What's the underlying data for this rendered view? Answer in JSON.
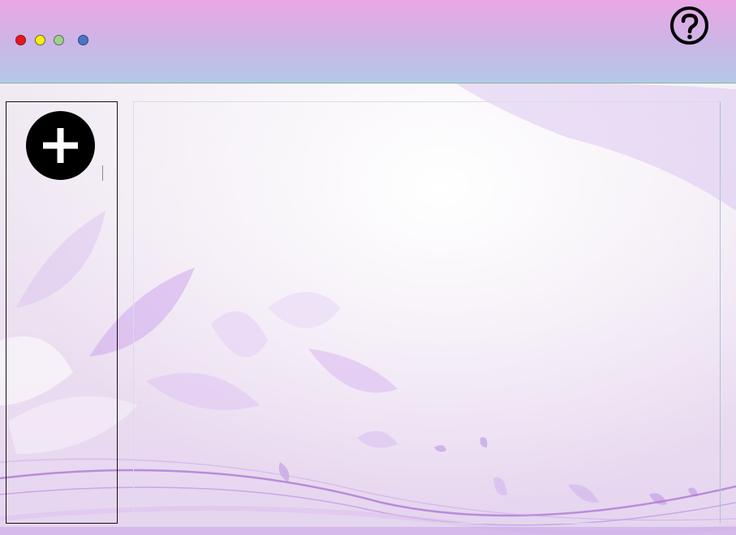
{
  "window": {
    "controls": [
      {
        "name": "close",
        "color": "#e8141e"
      },
      {
        "name": "minimize",
        "color": "#f3f018"
      },
      {
        "name": "maximize",
        "color": "#9fcf8a"
      },
      {
        "name": "extra",
        "color": "#4a74c8"
      }
    ]
  },
  "toolbar": {
    "help_icon": "question-circle-icon"
  },
  "sidebar": {
    "add_icon": "plus-circle-icon"
  },
  "colors": {
    "titlebar_top": "#eba7e5",
    "titlebar_bottom": "#b3c8e8",
    "accent_purple": "#b07ad8"
  }
}
